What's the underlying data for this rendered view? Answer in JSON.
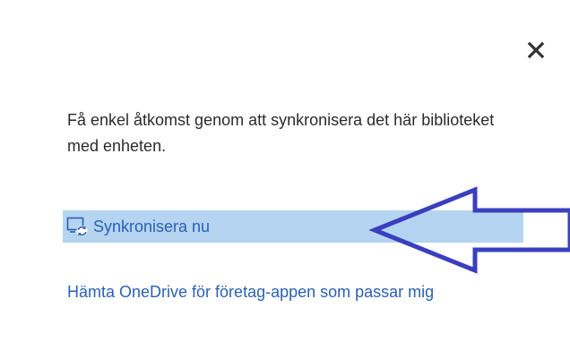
{
  "panel": {
    "close_icon": "close-icon",
    "description": "Få enkel åtkomst genom att synkronisera det här biblioteket med enheten.",
    "sync": {
      "icon": "sync-icon",
      "label": "Synkronisera nu"
    },
    "onedrive_link": "Hämta OneDrive för företag-appen som passar mig"
  },
  "colors": {
    "background": "#ffffff",
    "text": "#2b2b2b",
    "link": "#2b61b0",
    "highlight": "#b4d4f2",
    "annotation_arrow": "#3a3fbf"
  }
}
